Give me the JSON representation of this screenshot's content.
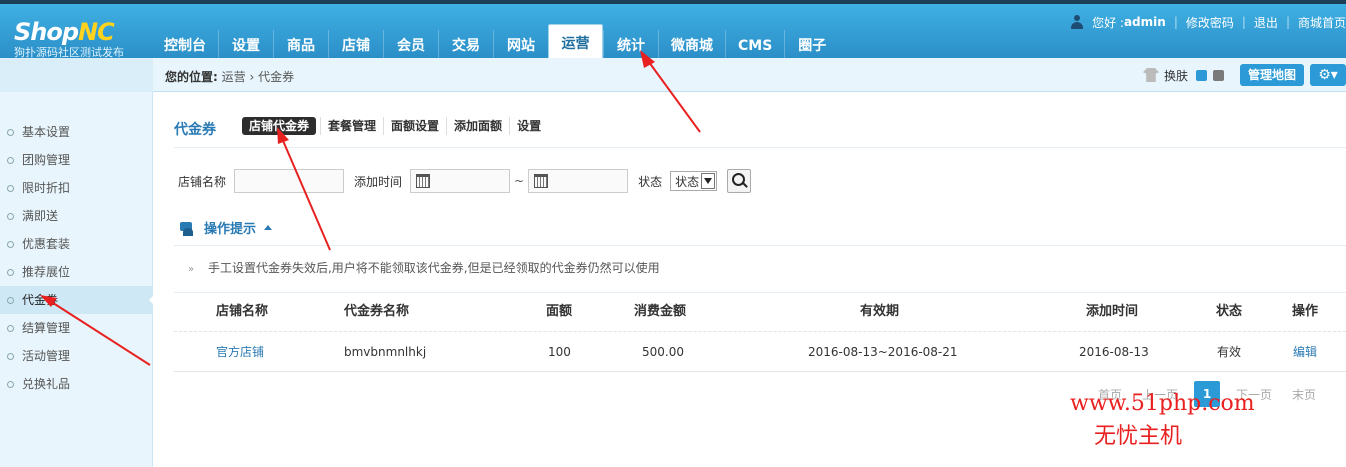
{
  "brand": {
    "logo_main": "Shop",
    "logo_accent": "NC",
    "logo_sub": "狗扑源码社区测试发布"
  },
  "nav": [
    "控制台",
    "设置",
    "商品",
    "店铺",
    "会员",
    "交易",
    "网站",
    "运营",
    "统计",
    "微商城",
    "CMS",
    "圈子"
  ],
  "nav_active": "运营",
  "user_bar": {
    "greeting": "您好 : ",
    "username": "admin",
    "change_password": "修改密码",
    "logout": "退出",
    "store_home": "商城首页"
  },
  "breadcrumb": {
    "label": "您的位置:",
    "parent": "运营",
    "current": "代金券"
  },
  "toolbar": {
    "skin_label": "换肤",
    "skin_colors": [
      "#2b9ad6",
      "#7a7a7a"
    ],
    "sitemap": "管理地图"
  },
  "sidebar": {
    "items": [
      "基本设置",
      "团购管理",
      "限时折扣",
      "满即送",
      "优惠套装",
      "推荐展位",
      "代金券",
      "结算管理",
      "活动管理",
      "兑换礼品"
    ],
    "active": "代金券"
  },
  "page": {
    "title": "代金券"
  },
  "tabs": [
    "店铺代金券",
    "套餐管理",
    "面额设置",
    "添加面额",
    "设置"
  ],
  "filter": {
    "store_name_label": "店铺名称",
    "add_time_label": "添加时间",
    "range_sep": "~",
    "status_label": "状态",
    "status_value": "状态"
  },
  "tips": {
    "title": "操作提示",
    "items": [
      "手工设置代金券失效后,用户将不能领取该代金券,但是已经领取的代金券仍然可以使用"
    ]
  },
  "table": {
    "columns": [
      "店铺名称",
      "代金券名称",
      "面额",
      "消费金额",
      "有效期",
      "添加时间",
      "状态",
      "操作"
    ],
    "rows": [
      {
        "store": "官方店铺",
        "name": "bmvbnmnlhkj",
        "amount": "100",
        "min_spend": "500.00",
        "validity": "2016-08-13~2016-08-21",
        "added": "2016-08-13",
        "status": "有效",
        "action": "编辑"
      }
    ]
  },
  "pager": {
    "first": "首页",
    "prev": "上一页",
    "current": "1",
    "next": "下一页",
    "last": "末页"
  },
  "watermark": {
    "line1": "www.51php.com",
    "line2": "无忧主机"
  },
  "colors": {
    "header": "#2b8fc7",
    "accent": "#2a7ab4",
    "annotation": "#e82020"
  }
}
